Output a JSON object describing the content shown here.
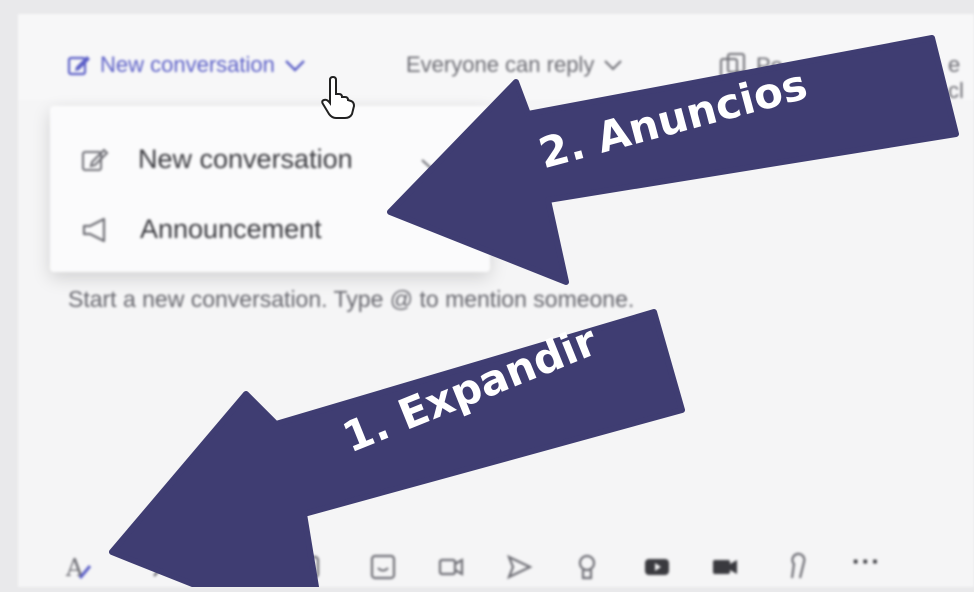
{
  "topbar": {
    "new_conversation": "New conversation",
    "everyone_can_reply": "Everyone can reply",
    "post_cut": "Po",
    "more_cut": "e cl"
  },
  "dropdown": {
    "items": [
      {
        "label": "New conversation",
        "icon": "compose-icon"
      },
      {
        "label": "Announcement",
        "icon": "megaphone-icon"
      }
    ]
  },
  "compose": {
    "placeholder": "Start a new conversation. Type @ to mention someone."
  },
  "annotations": {
    "arrow_2": "2. Anuncios",
    "arrow_1": "1. Expandir",
    "arrow_color": "#3f3d72"
  },
  "toolbar": {
    "icons": [
      "format-icon",
      "attach-icon",
      "emoji-icon",
      "gif-icon",
      "sticker-icon",
      "meet-now-icon",
      "send-icon",
      "praise-icon",
      "youtube-icon",
      "video-icon",
      "idea-icon",
      "more-icon"
    ],
    "more_label": "···"
  }
}
